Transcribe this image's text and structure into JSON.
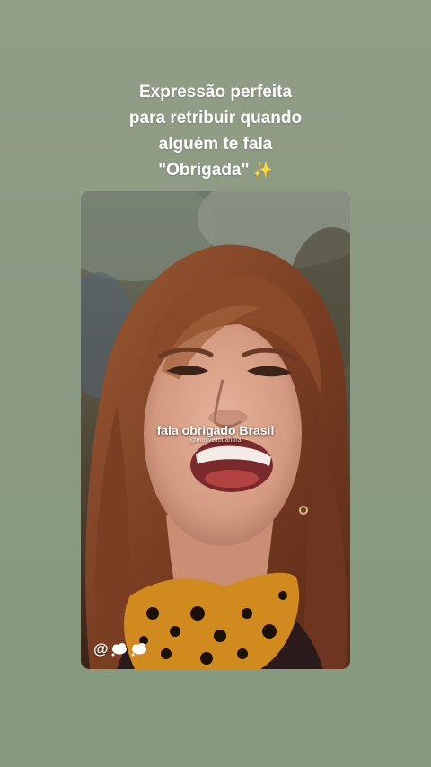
{
  "caption": {
    "lines": [
      "Expressão perfeita",
      "para retribuir quando",
      "alguém te fala",
      "\"Obrigada\""
    ],
    "emoji_icon": "sparkles-icon",
    "emoji_glyph": "✨"
  },
  "video": {
    "subtitle": "fala obrigado Brasil",
    "watermark": "@motiveitodahora",
    "handle_prefix": "@",
    "handle_icons": [
      "thought-balloon-icon",
      "thought-balloon-icon"
    ]
  },
  "colors": {
    "background": "#8c9a82",
    "caption_text": "#ffffff",
    "hair": "#8a4a2a",
    "skin": "#d9a48a",
    "scarf_base": "#d08a1e"
  }
}
